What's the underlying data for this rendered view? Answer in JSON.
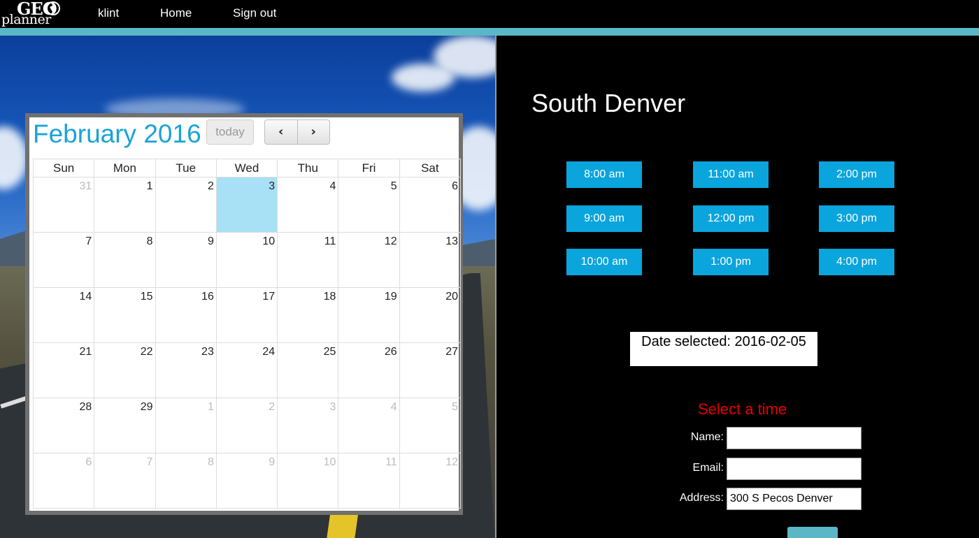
{
  "nav": {
    "logo_top": "GEO",
    "logo_bottom": "planner",
    "links": [
      "klint",
      "Home",
      "Sign out"
    ]
  },
  "calendar": {
    "title": "February 2016",
    "today_label": "today",
    "prev_label": "‹",
    "next_label": "›",
    "weekdays": [
      "Sun",
      "Mon",
      "Tue",
      "Wed",
      "Thu",
      "Fri",
      "Sat"
    ],
    "weeks": [
      [
        "31",
        "1",
        "2",
        "3",
        "4",
        "5",
        "6"
      ],
      [
        "7",
        "8",
        "9",
        "10",
        "11",
        "12",
        "13"
      ],
      [
        "14",
        "15",
        "16",
        "17",
        "18",
        "19",
        "20"
      ],
      [
        "21",
        "22",
        "23",
        "24",
        "25",
        "26",
        "27"
      ],
      [
        "28",
        "29",
        "1",
        "2",
        "3",
        "4",
        "5"
      ],
      [
        "6",
        "7",
        "8",
        "9",
        "10",
        "11",
        "12"
      ]
    ]
  },
  "location": {
    "title": "South Denver"
  },
  "time_slots": [
    "8:00 am",
    "11:00 am",
    "2:00 pm",
    "9:00 am",
    "12:00 pm",
    "3:00 pm",
    "10:00 am",
    "1:00 pm",
    "4:00 pm"
  ],
  "selection": {
    "date_text": "Date selected: 2016-02-05"
  },
  "form": {
    "heading": "Select a time",
    "name_label": "Name:",
    "email_label": "Email:",
    "address_label": "Address:",
    "name_value": "",
    "email_value": "",
    "address_value": "300 S Pecos Denver"
  },
  "colors": {
    "accent": "#5ab8c6",
    "slot_button": "#0aa5dc",
    "calendar_title": "#1aa3d6",
    "today_cell": "#a8e1f5",
    "heading_red": "#e60000"
  }
}
